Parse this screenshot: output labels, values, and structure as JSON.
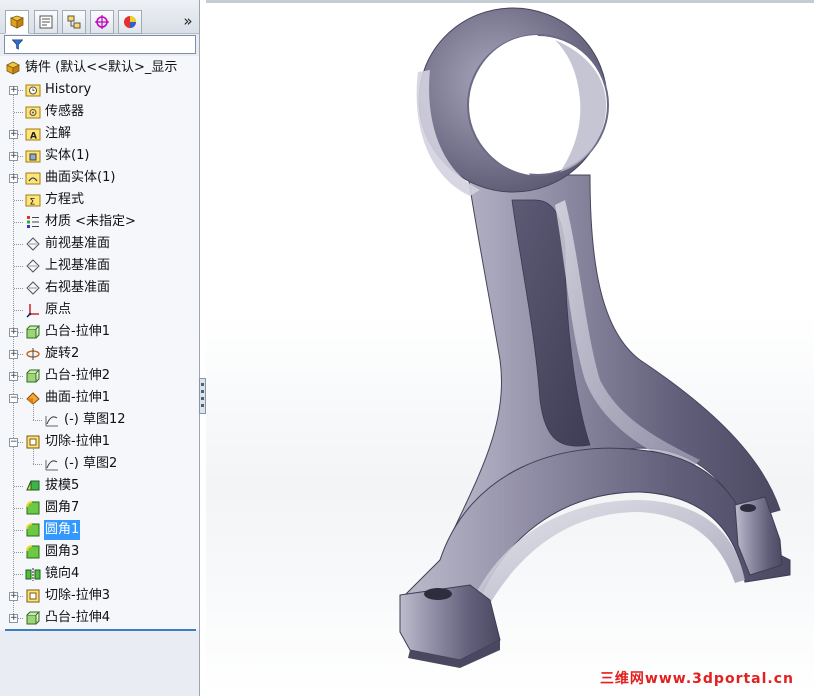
{
  "feature_tree": {
    "items": [
      {
        "label": "铸件  (默认<<默认>_显示",
        "icon": "part-icon"
      },
      {
        "label": "History",
        "icon": "history-folder-icon"
      },
      {
        "label": "传感器",
        "icon": "sensor-folder-icon"
      },
      {
        "label": "注解",
        "icon": "annotation-folder-icon"
      },
      {
        "label": "实体(1)",
        "icon": "solid-bodies-folder-icon"
      },
      {
        "label": "曲面实体(1)",
        "icon": "surface-bodies-folder-icon"
      },
      {
        "label": "方程式",
        "icon": "equations-folder-icon"
      },
      {
        "label": "材质 <未指定>",
        "icon": "material-icon"
      },
      {
        "label": "前视基准面",
        "icon": "plane-icon"
      },
      {
        "label": "上视基准面",
        "icon": "plane-icon"
      },
      {
        "label": "右视基准面",
        "icon": "plane-icon"
      },
      {
        "label": "原点",
        "icon": "origin-icon"
      },
      {
        "label": "凸台-拉伸1",
        "icon": "boss-extrude-icon"
      },
      {
        "label": "旋转2",
        "icon": "revolve-icon"
      },
      {
        "label": "凸台-拉伸2",
        "icon": "boss-extrude-icon"
      },
      {
        "label": "曲面-拉伸1",
        "icon": "surface-extrude-icon"
      },
      {
        "label": "(-) 草图12",
        "icon": "sketch-icon"
      },
      {
        "label": "切除-拉伸1",
        "icon": "cut-extrude-icon"
      },
      {
        "label": "(-) 草图2",
        "icon": "sketch-icon"
      },
      {
        "label": "拔模5",
        "icon": "draft-icon"
      },
      {
        "label": "圆角7",
        "icon": "fillet-icon"
      },
      {
        "label": "圆角1",
        "icon": "fillet-icon"
      },
      {
        "label": "圆角3",
        "icon": "fillet-icon"
      },
      {
        "label": "镜向4",
        "icon": "mirror-icon"
      },
      {
        "label": "切除-拉伸3",
        "icon": "cut-extrude-icon"
      },
      {
        "label": "凸台-拉伸4",
        "icon": "boss-extrude-icon"
      }
    ],
    "selected": "圆角1"
  },
  "tabs": [
    "featuremanager-tab",
    "propertymanager-tab",
    "configurationmanager-tab",
    "dimxpert-tab",
    "display-manager-tab"
  ],
  "more_tabs": "»",
  "watermark": "三维网www.3dportal.cn",
  "colors": {
    "selection": "#3399ff",
    "model": "#6e6b85",
    "watermark": "#e2201f"
  }
}
